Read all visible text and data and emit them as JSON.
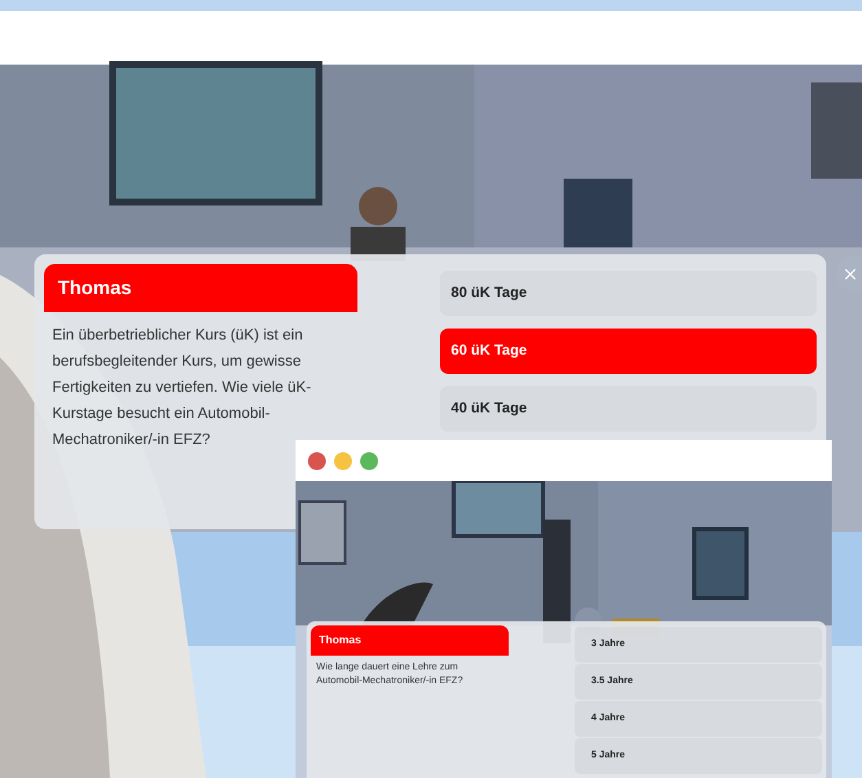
{
  "main_dialog": {
    "speaker": "Thomas",
    "question": "Ein überbetrieblicher Kurs (üK) ist ein berufsbegleitender Kurs, um gewisse Fertigkeiten zu vertiefen. Wie viele üK-Kurstage besucht ein Automobil-Mechatroniker/-in EFZ?",
    "answers": [
      {
        "label": "80 üK Tage",
        "selected": false
      },
      {
        "label": "60 üK Tage",
        "selected": true
      },
      {
        "label": "40 üK Tage",
        "selected": false
      }
    ]
  },
  "inset_window": {
    "window_controls": [
      {
        "color": "#d9534f"
      },
      {
        "color": "#f5c242"
      },
      {
        "color": "#5cb85c"
      }
    ],
    "dialog": {
      "speaker": "Thomas",
      "question": "Wie lange dauert eine Lehre zum Automobil-Mechatroniker/-in EFZ?",
      "answers": [
        {
          "label": "3 Jahre",
          "selected": false
        },
        {
          "label": "3.5 Jahre",
          "selected": false
        },
        {
          "label": "4 Jahre",
          "selected": false
        },
        {
          "label": "5 Jahre",
          "selected": false
        }
      ]
    }
  }
}
